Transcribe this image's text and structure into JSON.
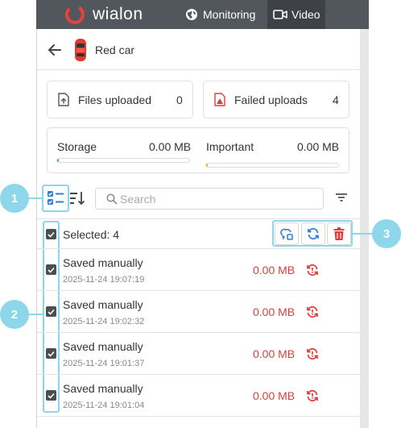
{
  "header": {
    "brand": "wialon",
    "nav": [
      {
        "label": "Monitoring",
        "icon": "globe-icon"
      },
      {
        "label": "Video",
        "icon": "video-camera-icon",
        "active": true
      }
    ]
  },
  "unit": {
    "name": "Red car",
    "icon": "car-icon"
  },
  "stats": {
    "files_uploaded": {
      "label": "Files uploaded",
      "value": "0"
    },
    "failed_uploads": {
      "label": "Failed uploads",
      "value": "4"
    }
  },
  "storage": {
    "storage": {
      "label": "Storage",
      "value": "0.00 MB",
      "fill_fraction": 0.01,
      "color": "#3fbf4f"
    },
    "important": {
      "label": "Important",
      "value": "0.00 MB",
      "fill_fraction": 0.01,
      "color": "#f2b511"
    }
  },
  "toolbar": {
    "search_placeholder": "Search"
  },
  "selection": {
    "label": "Selected: 4"
  },
  "files": [
    {
      "title": "Saved manually",
      "time": "2025-11-24 19:07:19",
      "size": "0.00 MB"
    },
    {
      "title": "Saved manually",
      "time": "2025-11-24 19:02:32",
      "size": "0.00 MB"
    },
    {
      "title": "Saved manually",
      "time": "2025-11-24 19:01:37",
      "size": "0.00 MB"
    },
    {
      "title": "Saved manually",
      "time": "2025-11-24 19:01:04",
      "size": "0.00 MB"
    }
  ],
  "callouts": [
    "1",
    "2",
    "3"
  ],
  "colors": {
    "accent": "#2d7fd3",
    "danger": "#e23b3b",
    "callout": "#8ed6ea",
    "topbar": "#52575d"
  }
}
